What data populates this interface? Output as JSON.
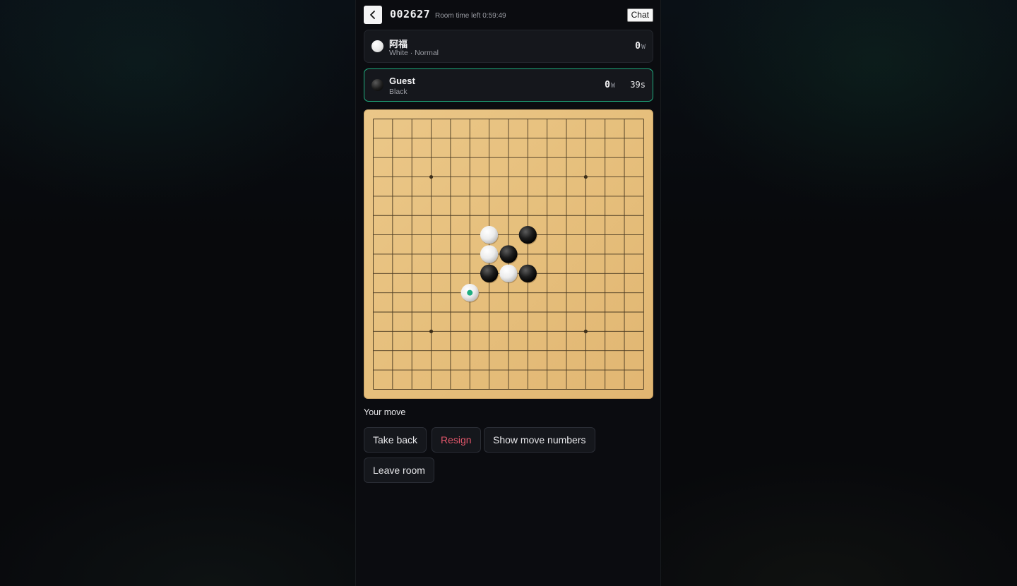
{
  "header": {
    "back_icon": "chevron-left-icon",
    "room_code": "002627",
    "room_time_left": "Room time left 0:59:49",
    "chat_label": "Chat"
  },
  "players": [
    {
      "name": "阿福",
      "subtitle": "White · Normal",
      "stone": "white",
      "score": "0",
      "score_unit": "W",
      "active": false
    },
    {
      "name": "Guest",
      "subtitle": "Black",
      "stone": "black",
      "score": "0",
      "score_unit": "W",
      "timer": "39s",
      "active": true
    }
  ],
  "board": {
    "size": 15,
    "star_points": [
      [
        3,
        3
      ],
      [
        11,
        3
      ],
      [
        3,
        11
      ],
      [
        11,
        11
      ]
    ],
    "stones": [
      {
        "col": 6,
        "row": 6,
        "color": "white"
      },
      {
        "col": 8,
        "row": 6,
        "color": "black"
      },
      {
        "col": 6,
        "row": 7,
        "color": "white"
      },
      {
        "col": 7,
        "row": 7,
        "color": "black"
      },
      {
        "col": 6,
        "row": 8,
        "color": "black"
      },
      {
        "col": 7,
        "row": 8,
        "color": "white"
      },
      {
        "col": 8,
        "row": 8,
        "color": "black"
      },
      {
        "col": 5,
        "row": 9,
        "color": "white"
      }
    ],
    "last_move": {
      "col": 5,
      "row": 9
    },
    "last_move_marker_color": "#1fae7f"
  },
  "status_text": "Your move",
  "actions": {
    "take_back": "Take back",
    "resign": "Resign",
    "show_move_numbers": "Show move numbers",
    "leave_room": "Leave room"
  },
  "colors": {
    "accent": "#1fae7f",
    "danger": "#e0566a",
    "board": "#e6bf7c"
  }
}
